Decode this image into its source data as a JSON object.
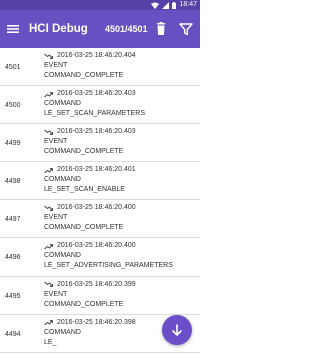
{
  "status_bar": {
    "time": "18:47"
  },
  "toolbar": {
    "title": "HCI Debug",
    "counter": "4501/4501"
  },
  "colors": {
    "status_bar": "#5541a8",
    "toolbar": "#6650c2",
    "fab": "#6b4fc8",
    "text": "#2f2f2f",
    "divider": "#dcdcdc"
  },
  "icons": {
    "menu": "menu-icon",
    "trash": "trash-icon",
    "filter": "filter-icon",
    "incoming": "arrow-incoming-icon",
    "outgoing": "arrow-outgoing-icon",
    "fab": "arrow-down-icon"
  },
  "entries": [
    {
      "index": "4501",
      "direction": "incoming",
      "timestamp": "2016-03-25 18:46:20.404",
      "type": "EVENT",
      "name": "COMMAND_COMPLETE"
    },
    {
      "index": "4500",
      "direction": "outgoing",
      "timestamp": "2016-03-25 18:46:20.403",
      "type": "COMMAND",
      "name": "LE_SET_SCAN_PARAMETERS"
    },
    {
      "index": "4499",
      "direction": "incoming",
      "timestamp": "2016-03-25 18:46:20.403",
      "type": "EVENT",
      "name": "COMMAND_COMPLETE"
    },
    {
      "index": "4498",
      "direction": "outgoing",
      "timestamp": "2016-03-25 18:46:20.401",
      "type": "COMMAND",
      "name": "LE_SET_SCAN_ENABLE"
    },
    {
      "index": "4497",
      "direction": "incoming",
      "timestamp": "2016-03-25 18:46:20.400",
      "type": "EVENT",
      "name": "COMMAND_COMPLETE"
    },
    {
      "index": "4496",
      "direction": "outgoing",
      "timestamp": "2016-03-25 18:46:20.400",
      "type": "COMMAND",
      "name": "LE_SET_ADVERTISING_PARAMETERS"
    },
    {
      "index": "4495",
      "direction": "incoming",
      "timestamp": "2016-03-25 18:46:20.399",
      "type": "EVENT",
      "name": "COMMAND_COMPLETE"
    },
    {
      "index": "4494",
      "direction": "outgoing",
      "timestamp": "2016-03-25 18:46:20.398",
      "type": "COMMAND",
      "name": "LE_"
    }
  ]
}
